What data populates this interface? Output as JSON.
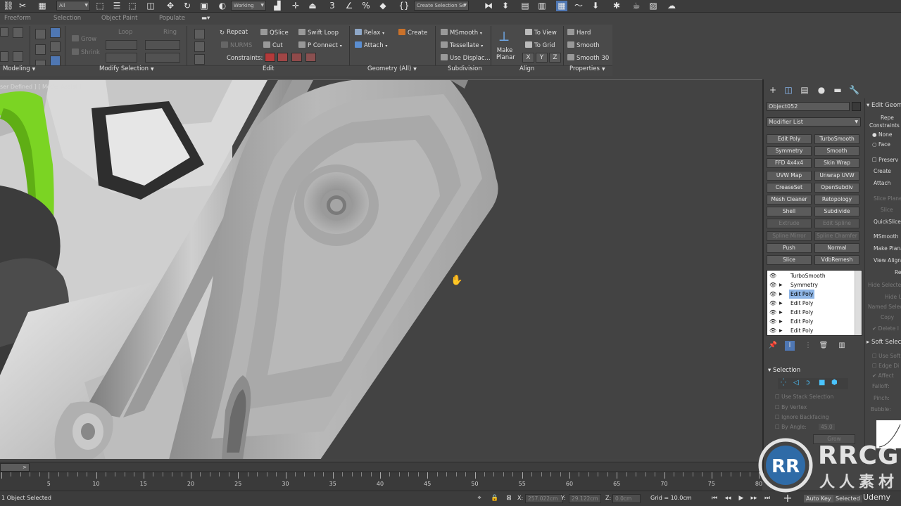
{
  "toolbar": {
    "filter_value": "All",
    "working_value": "Working",
    "selection_set_value": "Create Selection Se"
  },
  "tabs": [
    "Freeform",
    "Selection",
    "Object Paint",
    "Populate"
  ],
  "ribbon": {
    "modeling": {
      "label": "Modeling"
    },
    "modify_selection": {
      "label": "Modify Selection",
      "grow": "Grow",
      "shrink": "Shrink",
      "loop": "Loop",
      "ring": "Ring"
    },
    "edit": {
      "label": "Edit",
      "repeat": "Repeat",
      "qslice": "QSlice",
      "swift_loop": "Swift Loop",
      "nurms": "NURMS",
      "cut": "Cut",
      "p_connect": "P Connect",
      "constraints": "Constraints:"
    },
    "geometry": {
      "label": "Geometry (All)",
      "relax": "Relax",
      "create": "Create",
      "attach": "Attach"
    },
    "subdivision": {
      "label": "Subdivision",
      "msmooth": "MSmooth",
      "tessellate": "Tessellate",
      "use_displace": "Use Displac..."
    },
    "align": {
      "label": "Align",
      "make_planar": "Make Planar",
      "to_view": "To View",
      "to_grid": "To Grid",
      "x": "X",
      "y": "Y",
      "z": "Z"
    },
    "properties": {
      "label": "Properties",
      "hard": "Hard",
      "smooth": "Smooth",
      "smooth30": "Smooth 30"
    }
  },
  "viewport": {
    "label": "ser Defined ] [ Model Assist ]"
  },
  "command_panel": {
    "object_name": "Object052",
    "modifier_list": "Modifier List",
    "modifiers": [
      [
        "Edit Poly",
        "TurboSmooth"
      ],
      [
        "Symmetry",
        "Smooth"
      ],
      [
        "FFD 4x4x4",
        "Skin Wrap"
      ],
      [
        "UVW Map",
        "Unwrap UVW"
      ],
      [
        "CreaseSet",
        "OpenSubdiv"
      ],
      [
        "Mesh Cleaner",
        "Retopology"
      ],
      [
        "Shell",
        "Subdivide"
      ],
      [
        "Extrude",
        "Edit Spline"
      ],
      [
        "Spline Mirror",
        "Spline Chamfer"
      ],
      [
        "Push",
        "Normal"
      ],
      [
        "Slice",
        "VdbRemesh"
      ]
    ],
    "stack": [
      {
        "name": "TurboSmooth",
        "expand": false,
        "selected": false
      },
      {
        "name": "Symmetry",
        "expand": true,
        "selected": false
      },
      {
        "name": "Edit Poly",
        "expand": true,
        "selected": true
      },
      {
        "name": "Edit Poly",
        "expand": true,
        "selected": false
      },
      {
        "name": "Edit Poly",
        "expand": true,
        "selected": false
      },
      {
        "name": "Edit Poly",
        "expand": true,
        "selected": false
      },
      {
        "name": "Edit Poly",
        "expand": true,
        "selected": false
      }
    ],
    "selection_rollout": {
      "title": "Selection",
      "use_stack": "Use Stack Selection",
      "by_vertex": "By Vertex",
      "ignore_backfacing": "Ignore Backfacing",
      "by_angle": "By Angle:",
      "angle_value": "45.0",
      "grow": "Grow"
    }
  },
  "right_panel": {
    "edit_geom": "Edit Geom",
    "repeat": "Repe",
    "constraints": "Constraints",
    "none": "None",
    "face": "Face",
    "preserve": "Preserv",
    "create": "Create",
    "attach": "Attach",
    "slice_plane": "Slice Plane",
    "slice": "Slice",
    "quickslice": "QuickSlice",
    "msmooth": "MSmooth",
    "make_planar": "Make Plana",
    "view_align": "View Align",
    "re": "Re",
    "hide_selected": "Hide Selecte",
    "hide_u": "Hide U",
    "named_selec": "Named Selec",
    "copy": "Copy",
    "delete_i": "Delete I",
    "soft_selection": "Soft Selec",
    "use_soft": "Use Soft",
    "edge_di": "Edge Di",
    "affect": "Affect",
    "falloff": "Falloff:",
    "pinch": "Pinch:",
    "bubble": "Bubble:"
  },
  "timeline": {
    "frame_label": ">",
    "ticks": [
      "5",
      "10",
      "15",
      "20",
      "25",
      "30",
      "35",
      "40",
      "45",
      "50",
      "55",
      "60",
      "65",
      "70",
      "75",
      "80"
    ]
  },
  "status": {
    "selected_text": "1 Object Selected",
    "x_label": "X:",
    "x_value": "257.022cm",
    "y_label": "Y:",
    "y_value": "29.122cm",
    "z_label": "Z:",
    "z_value": "0.0cm",
    "grid": "Grid = 10.0cm",
    "auto_key": "Auto Key",
    "selected": "Selected",
    "udemy": "Udemy"
  },
  "watermark": {
    "brand": "RRCG",
    "sub": "人人素材"
  },
  "colors": {
    "accent": "#4f77b3",
    "green_part": "#7bd423",
    "viewport_bg": "#434343"
  }
}
